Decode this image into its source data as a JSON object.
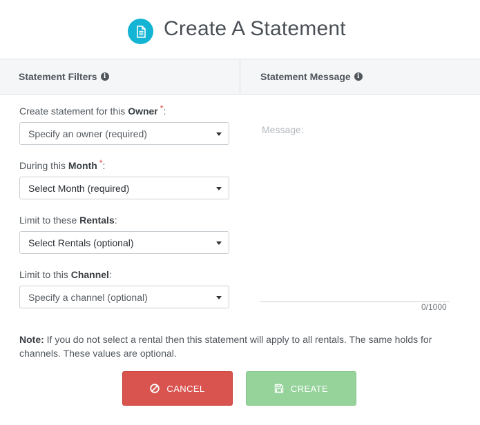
{
  "header": {
    "title": "Create A Statement",
    "icon": "document-icon"
  },
  "subheader": {
    "filters_label": "Statement Filters",
    "message_label": "Statement Message"
  },
  "filters": {
    "owner": {
      "prefix": "Create statement for this ",
      "bold": "Owner",
      "required_mark": "*",
      "suffix": ":",
      "placeholder": "Specify an owner (required)"
    },
    "month": {
      "prefix": "During this ",
      "bold": "Month",
      "required_mark": "*",
      "suffix": ":",
      "value": "Select Month (required)"
    },
    "rentals": {
      "prefix": "Limit to these ",
      "bold": "Rentals",
      "suffix": ":",
      "value": "Select Rentals (optional)"
    },
    "channel": {
      "prefix": "Limit to this ",
      "bold": "Channel",
      "suffix": ":",
      "placeholder": "Specify a channel (optional)"
    }
  },
  "message": {
    "placeholder": "Message:",
    "char_count": "0/1000"
  },
  "note": {
    "label": "Note:",
    "text": " If you do not select a rental then this statement will apply to all rentals. The same holds for channels. These values are optional."
  },
  "buttons": {
    "cancel": "CANCEL",
    "create": "CREATE"
  },
  "colors": {
    "accent": "#14b4d4",
    "cancel": "#d9534f",
    "create": "#96d39b",
    "required": "#e03a3a"
  }
}
